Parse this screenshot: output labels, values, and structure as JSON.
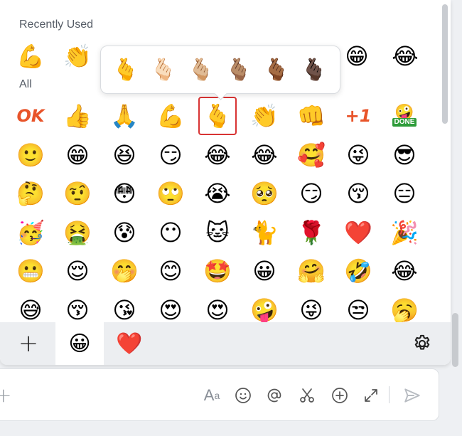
{
  "sections": {
    "recently_used": "Recently Used",
    "all": "All"
  },
  "recently_used_emojis": [
    "💪",
    "👏",
    "😁",
    "😂"
  ],
  "skin_tone_options": [
    "🫰",
    "🫰🏻",
    "🫰🏼",
    "🫰🏽",
    "🫰🏾",
    "🫰🏿"
  ],
  "all_emojis": [
    [
      "OK",
      "👍",
      "🙏",
      "💪",
      "🫰",
      "👏",
      "👊",
      "+1",
      "🤪"
    ],
    [
      "🙂",
      "😁",
      "😆",
      "😏",
      "😂",
      "😂",
      "🥰",
      "😜",
      "😎"
    ],
    [
      "🤔",
      "🤨",
      "😳",
      "🙄",
      "😭",
      "🥺",
      "😏",
      "😚",
      "😑"
    ],
    [
      "🥳",
      "🤮",
      "😰",
      "😶",
      "🐱",
      "🐈",
      "🌹",
      "❤️",
      "🎉"
    ],
    [
      "😬",
      "😌",
      "🤭",
      "😊",
      "🤩",
      "😀",
      "🤗",
      "🤣",
      "😂"
    ],
    [
      "😅",
      "😚",
      "😘",
      "😍",
      "😍",
      "🤪",
      "😜",
      "😒",
      "🥱"
    ]
  ],
  "done_label": "DONE",
  "tabs": [
    {
      "name": "add",
      "glyph": "+"
    },
    {
      "name": "emoji",
      "glyph": "😀"
    },
    {
      "name": "favorites",
      "glyph": "❤️"
    }
  ],
  "input_tools": {
    "font_aa": "A",
    "font_a_small": "a"
  },
  "colors": {
    "selected_outline": "#d83333",
    "section_label": "#555c66",
    "tab_bar": "#eceef1"
  }
}
